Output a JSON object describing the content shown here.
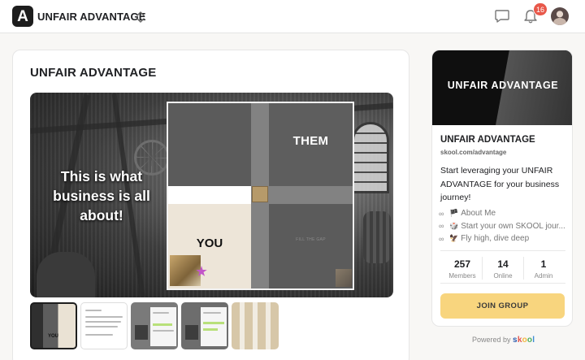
{
  "header": {
    "logo_letter": "A",
    "group_name": "UNFAIR ADVANTAGE",
    "notifications_count": "16",
    "icons": [
      "group-switcher-icon",
      "chat-icon",
      "bell-icon"
    ]
  },
  "main": {
    "title": "UNFAIR ADVANTAGE",
    "hero": {
      "caption": "This is what business is all about!",
      "quadrant_top_right": "THEM",
      "quadrant_bottom_left": "YOU",
      "quadrant_bottom_right": "FILL THE GAP"
    },
    "thumbnails": [
      "thumbnail-1",
      "thumbnail-2",
      "thumbnail-3",
      "thumbnail-4",
      "thumbnail-5"
    ]
  },
  "sidebar": {
    "cover_text": "UNFAIR ADVANTAGE",
    "title": "UNFAIR ADVANTAGE",
    "url": "skool.com/advantage",
    "description": "Start leveraging your UNFAIR ADVANTAGE for your business journey!",
    "links": [
      {
        "emoji": "🏴",
        "label": "About Me"
      },
      {
        "emoji": "🎲",
        "label": "Start your own SKOOL jour..."
      },
      {
        "emoji": "🦅",
        "label": "Fly high, dive deep"
      }
    ],
    "stats": [
      {
        "value": "257",
        "label": "Members"
      },
      {
        "value": "14",
        "label": "Online"
      },
      {
        "value": "1",
        "label": "Admin"
      }
    ],
    "join_label": "JOIN GROUP"
  },
  "footer": {
    "powered_by": "Powered by",
    "brand": "skool"
  },
  "colors": {
    "join_button": "#f8d57e",
    "badge": "#e8584a",
    "brand_dark": "#1d1d1d"
  }
}
